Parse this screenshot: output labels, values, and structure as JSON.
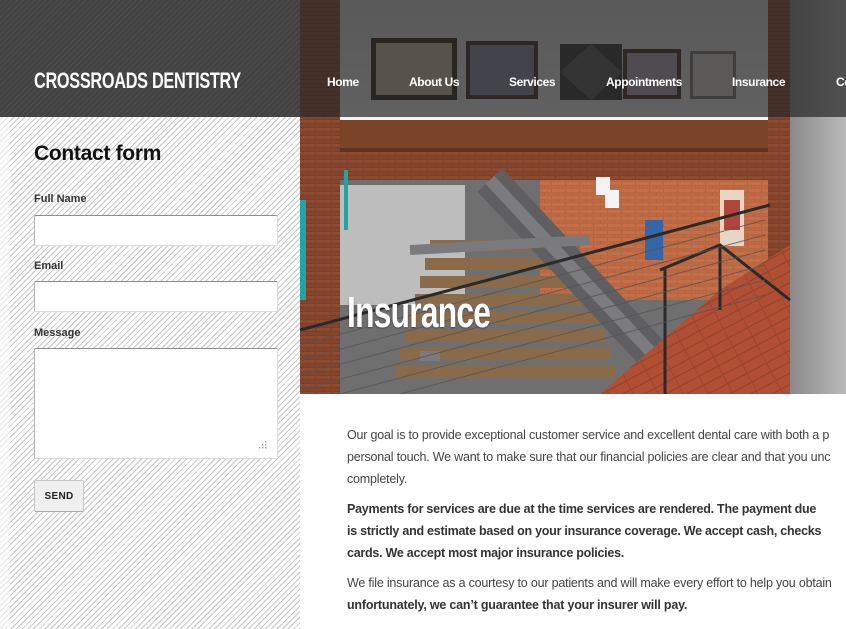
{
  "site": {
    "logo_text": "CROSSROADS DENTISTRY"
  },
  "nav": {
    "items": [
      {
        "label": "Home"
      },
      {
        "label": "About Us"
      },
      {
        "label": "Services"
      },
      {
        "label": "Appointments"
      },
      {
        "label": "Insurance"
      },
      {
        "label": "Co"
      }
    ]
  },
  "contact_form": {
    "title": "Contact form",
    "full_name_label": "Full Name",
    "full_name_value": "",
    "email_label": "Email",
    "email_value": "",
    "message_label": "Message",
    "message_value": "",
    "send_label": "SEND"
  },
  "hero": {
    "title": "Insurance",
    "image_description": "3D rendered interior of dental office loft with staircase, brick walls and framed art"
  },
  "content": {
    "paragraph1_lines": [
      "Our goal is to provide exceptional customer service and excellent dental care with both a p",
      "personal touch. We want to make sure that our financial policies are clear and that you unc",
      "completely."
    ],
    "paragraph2_lines": [
      "Payments for services are due at the time services are rendered. The payment due",
      "is strictly and estimate based on your insurance coverage. We accept cash, checks",
      "cards. We accept most major insurance policies."
    ],
    "paragraph3_line1": "We file insurance as a courtesy to our patients and will make every effort to help you obtain",
    "paragraph3_line2_bold": "unfortunately, we can’t guarantee that your insurer will pay."
  },
  "colors": {
    "header_bg": "#444444",
    "text_body": "#444444",
    "heading": "#111111",
    "white": "#ffffff"
  }
}
